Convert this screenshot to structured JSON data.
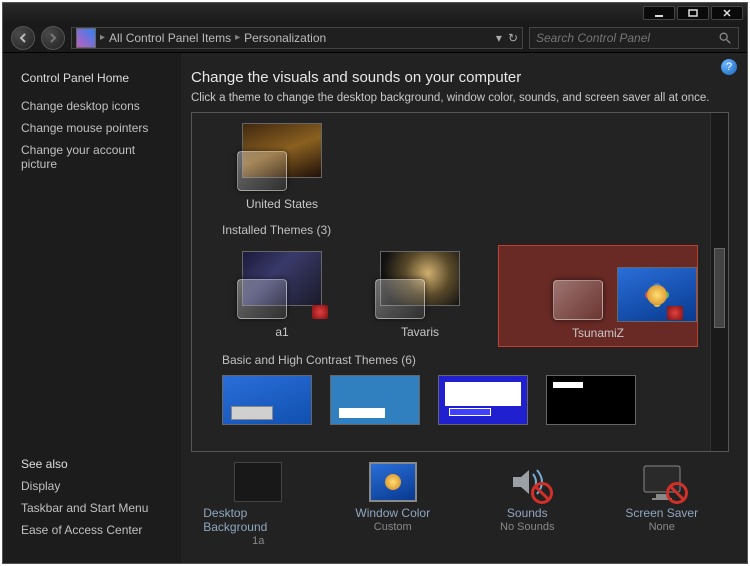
{
  "breadcrumb": {
    "parent": "All Control Panel Items",
    "current": "Personalization"
  },
  "search": {
    "placeholder": "Search Control Panel"
  },
  "sidebar": {
    "home": "Control Panel Home",
    "links": {
      "icons": "Change desktop icons",
      "pointers": "Change mouse pointers",
      "picture": "Change your account picture"
    },
    "see_also": "See also",
    "related": {
      "display": "Display",
      "taskbar": "Taskbar and Start Menu",
      "ease": "Ease of Access Center"
    }
  },
  "main": {
    "title": "Change the visuals and sounds on your computer",
    "subtitle": "Click a theme to change the desktop background, window color, sounds, and screen saver all at once.",
    "groups": {
      "aero_partial": {
        "us": "United States"
      },
      "installed": {
        "label": "Installed Themes (3)",
        "a1": "a1",
        "tavaris": "Tavaris",
        "tsunamiz": "TsunamiZ"
      },
      "basic": {
        "label": "Basic and High Contrast Themes (6)"
      }
    }
  },
  "bottom": {
    "desktop": {
      "label": "Desktop Background",
      "value": "1a"
    },
    "window": {
      "label": "Window Color",
      "value": "Custom"
    },
    "sounds": {
      "label": "Sounds",
      "value": "No Sounds"
    },
    "saver": {
      "label": "Screen Saver",
      "value": "None"
    }
  }
}
